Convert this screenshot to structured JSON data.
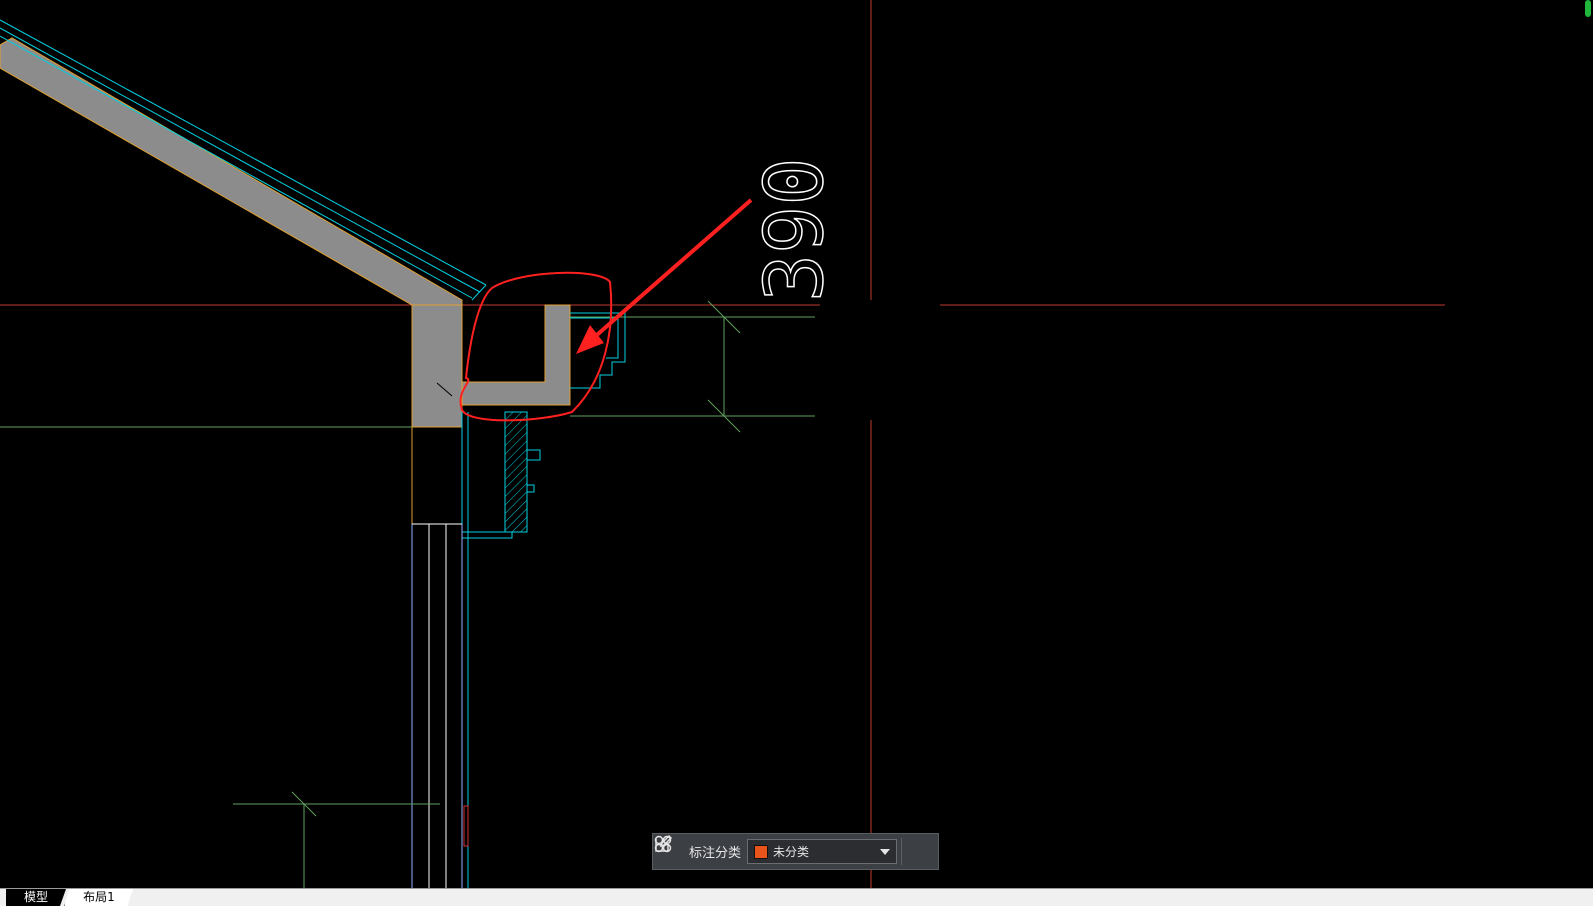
{
  "drawing": {
    "dimension_text": "390"
  },
  "annotation_toolbar": {
    "label": "标注分类",
    "category_value": "未分类",
    "category_color": "#e8541a"
  },
  "tabs": [
    {
      "label": "模型",
      "active": true
    },
    {
      "label": "布局1",
      "active": false
    }
  ],
  "colors": {
    "background": "#000000",
    "axis_red": "#c0392b",
    "cyan": "#00d0e0",
    "green_dim": "#5fa05f",
    "fill_gray": "#8c8c8c",
    "markup_red": "#ff2020"
  }
}
